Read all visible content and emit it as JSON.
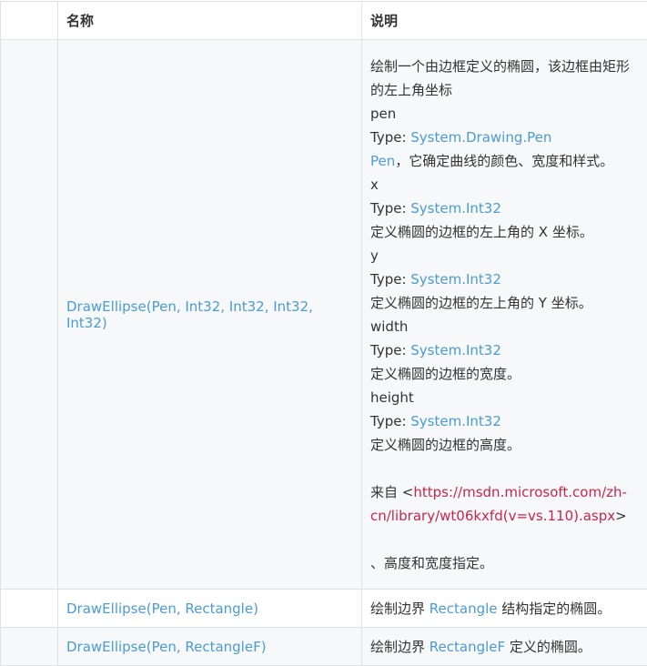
{
  "table": {
    "headers": {
      "name": "名称",
      "description": "说明"
    },
    "rows": [
      {
        "name": "DrawEllipse(Pen, Int32, Int32, Int32, Int32)",
        "desc_lines": [
          "绘制一个由边框定义的椭圆，该边框由矩形的左上角坐标",
          "pen"
        ],
        "pen_type_prefix": "Type: ",
        "pen_type": "System.Drawing.Pen",
        "pen_link": "Pen",
        "pen_desc": "，它确定曲线的颜色、宽度和样式。",
        "x_label": "x",
        "x_type_prefix": "Type: ",
        "x_type": "System.Int32",
        "x_desc": "定义椭圆的边框的左上角的 X 坐标。",
        "y_label": "y",
        "y_type_prefix": "Type: ",
        "y_type": "System.Int32",
        "y_desc": "定义椭圆的边框的左上角的 Y 坐标。",
        "width_label": "width",
        "width_type_prefix": "Type: ",
        "width_type": "System.Int32",
        "width_desc": "定义椭圆的边框的宽度。",
        "height_label": "height",
        "height_type_prefix": "Type: ",
        "height_type": "System.Int32",
        "height_desc": "定义椭圆的边框的高度。",
        "source_prefix": "来自 <",
        "source_url": "https://msdn.microsoft.com/zh-cn/library/wt06kxfd(v=vs.110).aspx",
        "source_suffix": ">",
        "tail": "、高度和宽度指定。"
      },
      {
        "name": "DrawEllipse(Pen, Rectangle)",
        "desc_prefix": "绘制边界 ",
        "desc_link": "Rectangle",
        "desc_suffix": " 结构指定的椭圆。"
      },
      {
        "name": "DrawEllipse(Pen, RectangleF)",
        "desc_prefix": "绘制边界 ",
        "desc_link": "RectangleF",
        "desc_suffix": " 定义的椭圆。"
      }
    ]
  }
}
